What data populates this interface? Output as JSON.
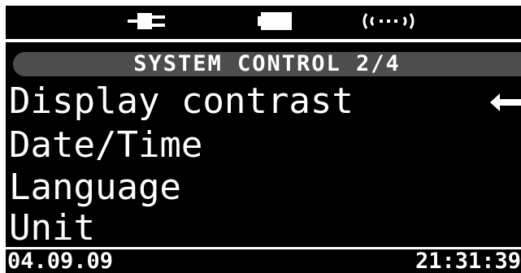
{
  "status_bar": {
    "icons": [
      "power-plug-icon",
      "battery-icon",
      "wireless-signal-icon"
    ]
  },
  "screen": {
    "title": "SYSTEM CONTROL 2/4",
    "menu_items": [
      {
        "label": "Display contrast",
        "selected": true
      },
      {
        "label": "Date/Time",
        "selected": false
      },
      {
        "label": "Language",
        "selected": false
      },
      {
        "label": "Unit",
        "selected": false
      }
    ],
    "selection_icon": "left-arrow-icon"
  },
  "footer": {
    "date": "04.09.09",
    "time": "21:31:39"
  },
  "colors": {
    "background": "#000000",
    "foreground": "#ffffff",
    "title_bar": "#4d4d4d"
  }
}
